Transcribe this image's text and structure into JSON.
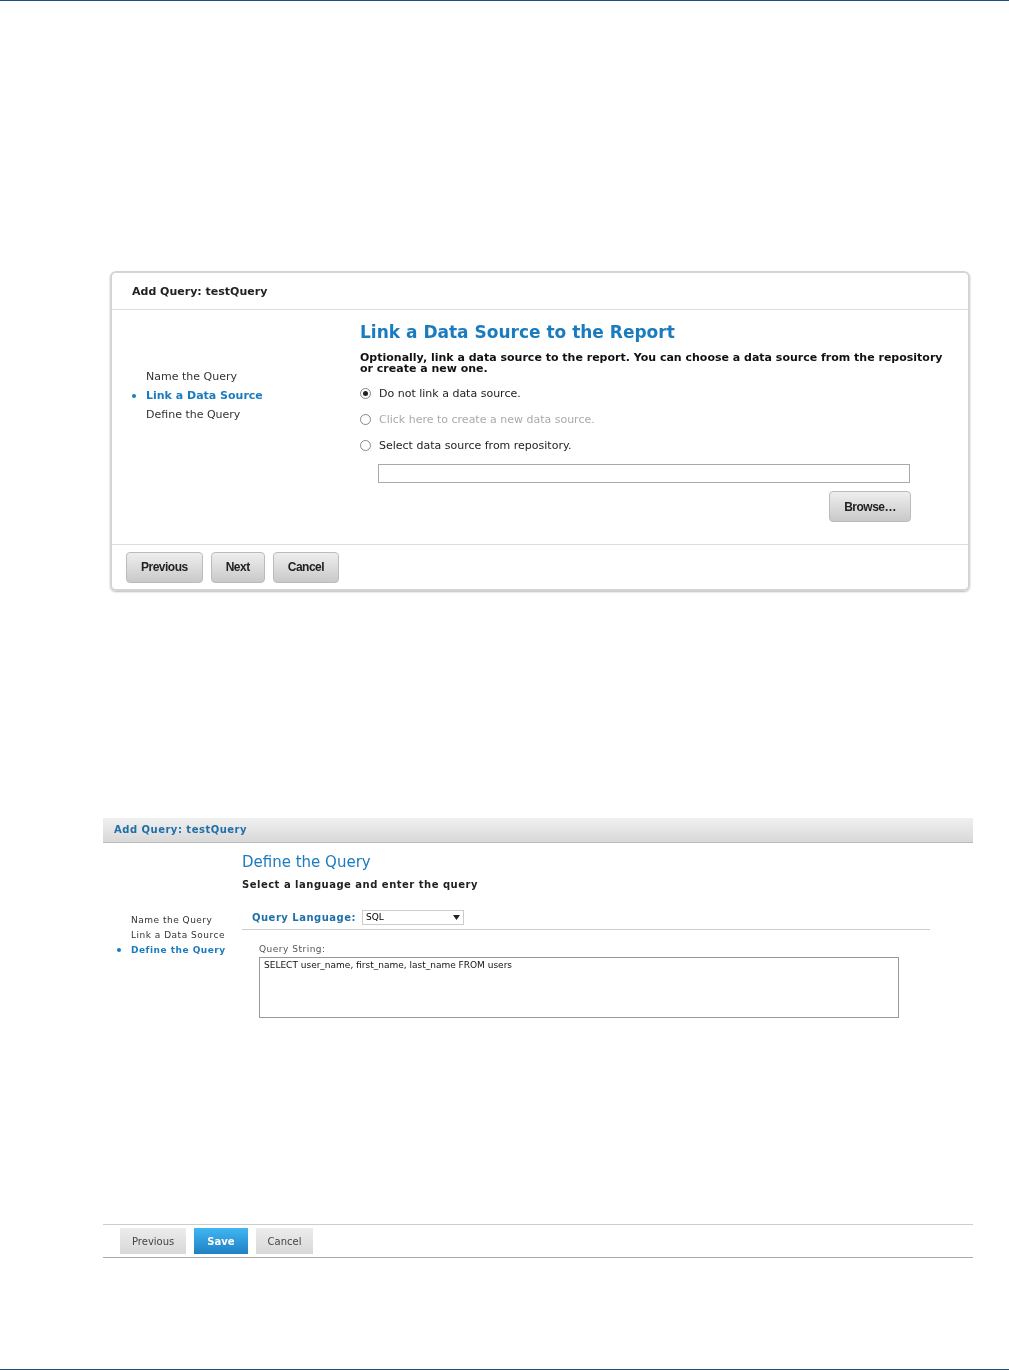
{
  "wizard_1": {
    "title": "Add Query: testQuery",
    "steps": [
      {
        "label": "Name the Query",
        "selected": false
      },
      {
        "label": "Link a Data Source",
        "selected": true
      },
      {
        "label": "Define the Query",
        "selected": false
      }
    ],
    "heading": "Link a Data Source to the Report",
    "instruction": "Optionally, link a data source to the report. You can choose a data source from the repository or create a new one.",
    "options": [
      {
        "label": "Do not link a data source.",
        "selected": true,
        "disabled": false
      },
      {
        "label": "Click here to create a new data source.",
        "selected": false,
        "disabled": true
      },
      {
        "label": "Select data source from repository.",
        "selected": false,
        "disabled": false
      }
    ],
    "browse_button": "Browse…",
    "buttons": [
      "Previous",
      "Next",
      "Cancel"
    ]
  },
  "wizard_2": {
    "title": "Add Query: testQuery",
    "steps": [
      {
        "label": "Name the Query",
        "selected": false
      },
      {
        "label": "Link a Data Source",
        "selected": false
      },
      {
        "label": "Define the Query",
        "selected": true
      }
    ],
    "heading": "Define the Query",
    "instruction": "Select a language and enter the query",
    "language_label": "Query Language:",
    "language_value": "SQL",
    "query_label": "Query String:",
    "query_value": "SELECT user_name, first_name, last_name FROM users",
    "buttons": [
      {
        "label": "Previous",
        "kind": "normal"
      },
      {
        "label": "Save",
        "kind": "primary"
      },
      {
        "label": "Cancel",
        "kind": "normal"
      }
    ]
  }
}
